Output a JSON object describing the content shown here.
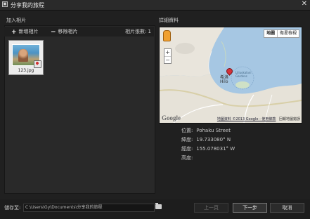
{
  "window": {
    "title": "分享我的旅程",
    "icon": "app-icon",
    "close_glyph": "✕"
  },
  "left": {
    "title": "加入相片",
    "add_label": "新增相片",
    "add_icon": "plus-icon",
    "remove_label": "移除相片",
    "remove_icon": "minus-icon",
    "count_label": "相片張數: 1",
    "photos": [
      {
        "name": "123.jpg"
      }
    ]
  },
  "right": {
    "title": "詳細資料",
    "map": {
      "type_map": "地圖",
      "type_satellite": "衛星檢視",
      "zoom_in": "+",
      "zoom_out": "−",
      "labels": {
        "city_cn": "希洛",
        "city_en": "Hilo",
        "garden": "Liliuokalani Gardens"
      },
      "logo": "Google",
      "attribution": "地圖資料 ©2013 Google - 使用條款",
      "report": "回報地圖錯誤"
    },
    "location_label": "位置:",
    "location_value": "Pohaku Street",
    "latitude_label": "緯度:",
    "latitude_value": "19.733080° N",
    "longitude_label": "經度:",
    "longitude_value": "155.078031° W",
    "altitude_label": "高度:",
    "altitude_value": ""
  },
  "footer": {
    "path_label": "儲存至:",
    "path_value": "C:\\Users\\Gy\\Documents\\分享我的旅程",
    "back_label": "上一頁",
    "next_label": "下一步",
    "cancel_label": "取消"
  },
  "colors": {
    "background": "#202020",
    "water": "#a6c7e3",
    "land": "#e9e5dc",
    "pin": "#d5323a"
  }
}
